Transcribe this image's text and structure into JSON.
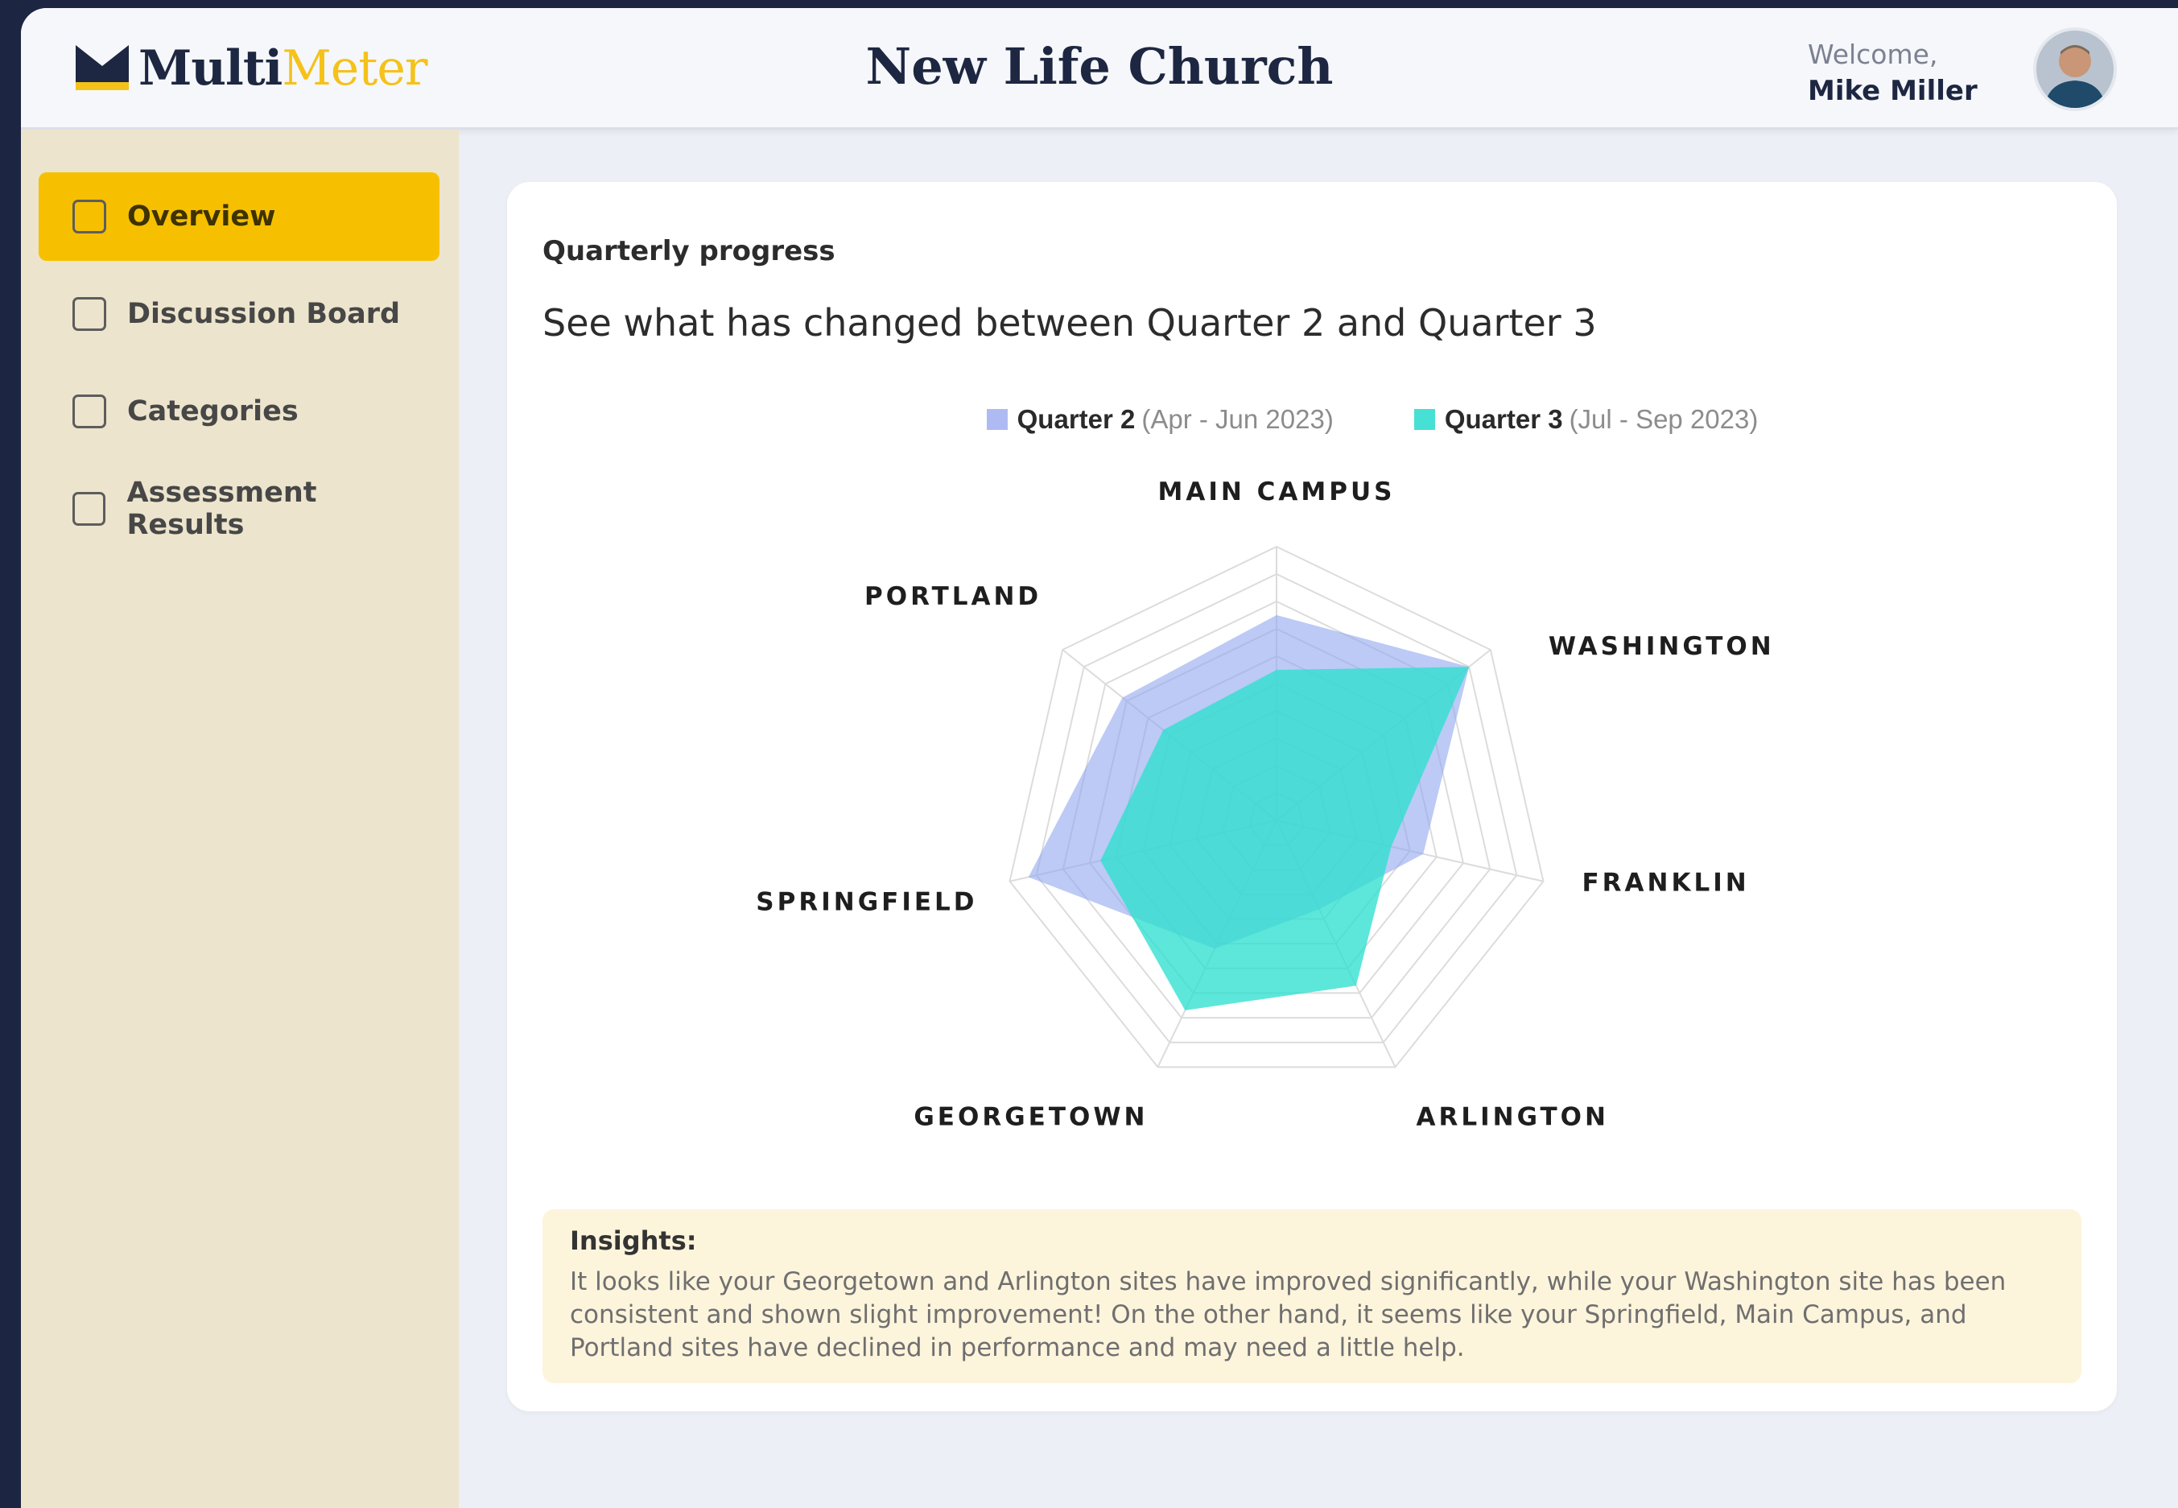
{
  "header": {
    "logo_part1": "Multi",
    "logo_part2": "Meter",
    "page_title": "New Life Church",
    "welcome_label": "Welcome,",
    "user_name": "Mike Miller"
  },
  "sidebar": {
    "items": [
      {
        "label": "Overview",
        "active": true
      },
      {
        "label": "Discussion Board",
        "active": false
      },
      {
        "label": "Categories",
        "active": false
      },
      {
        "label": "Assessment Results",
        "active": false
      }
    ]
  },
  "card": {
    "subtitle": "Quarterly progress",
    "title": "See what has changed between Quarter 2 and Quarter 3"
  },
  "legend": [
    {
      "name": "Quarter 2",
      "range": "(Apr - Jun 2023)",
      "color": "#aebbf3"
    },
    {
      "name": "Quarter 3",
      "range": "(Jul - Sep 2023)",
      "color": "#47e0d4"
    }
  ],
  "chart_data": {
    "type": "radar",
    "axes": [
      "MAIN CAMPUS",
      "WASHINGTON",
      "FRANKLIN",
      "ARLINGTON",
      "GEORGETOWN",
      "SPRINGFIELD",
      "PORTLAND"
    ],
    "rmax": 10,
    "rings": 10,
    "series": [
      {
        "name": "Quarter 2",
        "values": [
          7.5,
          9.0,
          5.5,
          3.6,
          5.2,
          9.3,
          7.2
        ],
        "color": "#8fa6ef"
      },
      {
        "name": "Quarter 3",
        "values": [
          5.5,
          9.0,
          4.3,
          6.7,
          7.7,
          6.6,
          5.3
        ],
        "color": "#2ee0cf"
      }
    ]
  },
  "insights": {
    "heading": "Insights:",
    "body": "It looks like your Georgetown and Arlington sites have improved significantly, while your Washington site has been consistent and shown slight improvement! On the other hand, it seems like your Springfield, Main Campus, and Portland sites have declined in performance and may need a little help."
  }
}
